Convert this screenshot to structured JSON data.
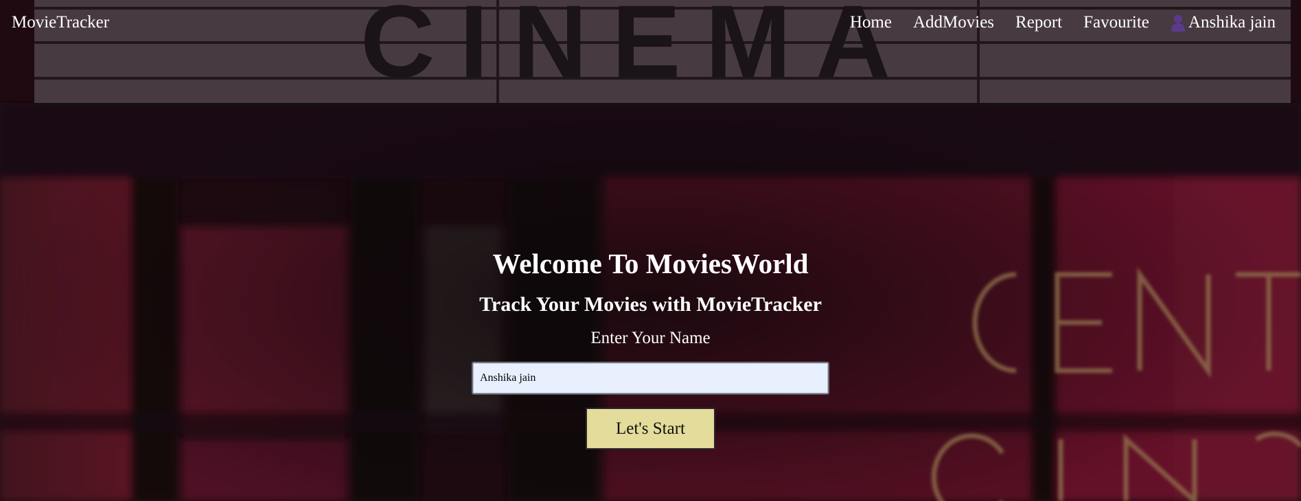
{
  "navbar": {
    "brand": "MovieTracker",
    "links": {
      "home": "Home",
      "add_movies": "AddMovies",
      "report": "Report",
      "favourite": "Favourite"
    },
    "user": {
      "icon": "user-icon",
      "name": "Anshika jain"
    }
  },
  "hero": {
    "title": "Welcome To MoviesWorld",
    "subtitle": "Track Your Movies with MovieTracker",
    "prompt": "Enter Your Name",
    "name_input": {
      "value": "Anshika jain"
    },
    "start_button": "Let's Start"
  },
  "background": {
    "sign_text": "CINEMA",
    "neon_text_top": "CENT",
    "neon_text_bottom": "CIN"
  },
  "colors": {
    "button_bg": "#e3dc9a",
    "input_bg": "#e8f0fe",
    "text": "#ffffff",
    "user_icon": "#5b3a8c"
  }
}
